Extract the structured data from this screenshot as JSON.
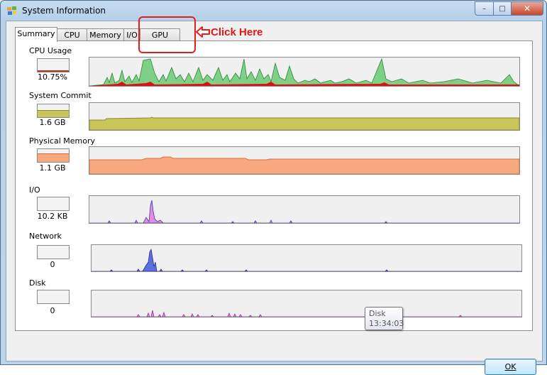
{
  "window": {
    "title": "System Information"
  },
  "caption": {
    "minimize": "–",
    "maximize": "□",
    "close": "✕"
  },
  "tabs": [
    {
      "label": "Summary",
      "active": true
    },
    {
      "label": "CPU",
      "active": false
    },
    {
      "label": "Memory",
      "active": false
    },
    {
      "label": "I/O",
      "active": false
    },
    {
      "label": "GPU",
      "active": false
    }
  ],
  "annotation": {
    "text": "Click Here",
    "color": "#e01818"
  },
  "sections": [
    {
      "label": "CPU Usage",
      "value": "10.75%",
      "level": 0.1075
    },
    {
      "label": "System Commit",
      "value": "1.6 GB"
    },
    {
      "label": "Physical Memory",
      "value": "1.1 GB"
    },
    {
      "label": "I/O",
      "value": "10.2  KB"
    },
    {
      "label": "Network",
      "value": "0"
    },
    {
      "label": "Disk",
      "value": "0"
    }
  ],
  "tooltip": {
    "title": "Disk",
    "time": "13:34:03"
  },
  "buttons": {
    "ok": "OK"
  },
  "colors": {
    "cpu_fill": "#7fcf86",
    "cpu_kernel": "#e01010",
    "commit_fill": "#c8c55a",
    "memory_fill": "#f7a87c",
    "io_fill": "#e48be4",
    "network_fill": "#5c6fe0",
    "disk_fill": "#e48be4"
  }
}
